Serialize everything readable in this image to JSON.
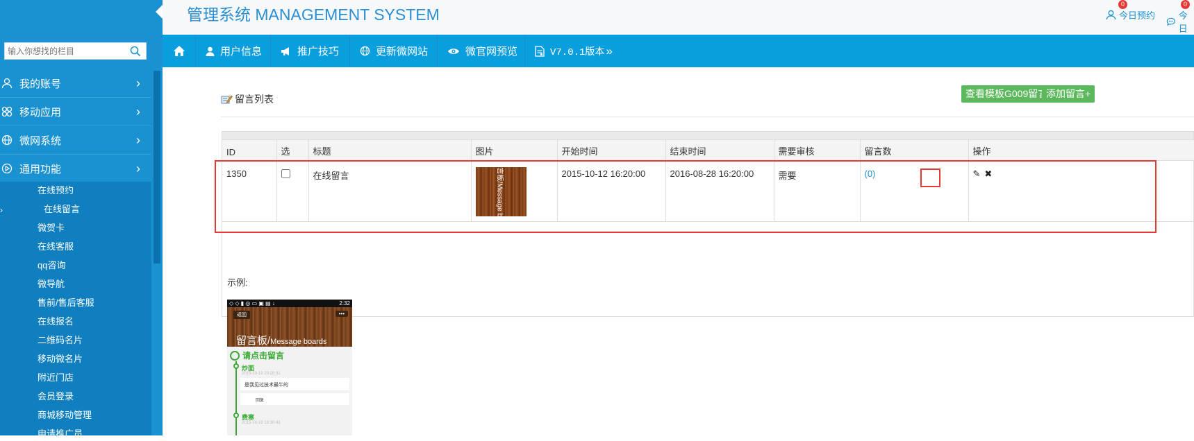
{
  "header": {
    "title": "管理系统 MANAGEMENT SYSTEM",
    "links": [
      {
        "label": "今日预约",
        "badge": "0"
      },
      {
        "label": "今日",
        "badge": "0"
      }
    ]
  },
  "sidebar": {
    "search_placeholder": "输入你想找的栏目",
    "menu": [
      {
        "label": "我的账号",
        "icon": "user-icon"
      },
      {
        "label": "移动应用",
        "icon": "apps-icon"
      },
      {
        "label": "微网系统",
        "icon": "globe-icon"
      },
      {
        "label": "通用功能",
        "icon": "play-circle-icon"
      }
    ],
    "submenu": [
      "在线预约",
      "在线留言",
      "微贺卡",
      "在线客服",
      "qq咨询",
      "微导航",
      "售前/售后客服",
      "在线报名",
      "二维码名片",
      "移动微名片",
      "附近门店",
      "会员登录",
      "商城移动管理",
      "申请推广员"
    ],
    "active_sub": "在线留言"
  },
  "navbar": {
    "home_icon": "home-icon",
    "items": [
      {
        "label": "用户信息",
        "icon": "user-icon"
      },
      {
        "label": "推广技巧",
        "icon": "megaphone-icon"
      },
      {
        "label": "更新微网站",
        "icon": "globe-icon"
      },
      {
        "label": "微官网预览",
        "icon": "eye-icon"
      },
      {
        "label": "V7.0.1版本",
        "icon": "document-icon"
      }
    ],
    "more": "»"
  },
  "main": {
    "page_title": "留言列表",
    "buttons": {
      "view_template": "查看模板G009留言",
      "add": "添加留言+"
    },
    "table": {
      "columns": [
        "ID",
        "选",
        "标题",
        "图片",
        "开始时间",
        "结束时间",
        "需要审核",
        "留言数",
        "操作"
      ],
      "rows": [
        {
          "id": "1350",
          "checked": false,
          "title": "在线留言",
          "image_text": "留言板/Message boards",
          "start": "2015-10-12 16:20:00",
          "end": "2016-08-28 16:20:00",
          "review": "需要",
          "count": "(0)",
          "actions": [
            "edit-icon",
            "delete-icon"
          ]
        }
      ]
    },
    "example": {
      "label": "示例:",
      "phone": {
        "status_time": "2:32",
        "back": "返回",
        "more": "•••",
        "title_cn": "留言板/",
        "title_en": "Message boards",
        "cta": "请点击留言",
        "entries": [
          {
            "name": "炒面",
            "date": "2015-10-19 20:28:31",
            "message": "是我见过技术最牛的",
            "reply": "回复"
          },
          {
            "name": "费寒",
            "date": "2015-10-19 19:30:41"
          }
        ]
      }
    }
  }
}
